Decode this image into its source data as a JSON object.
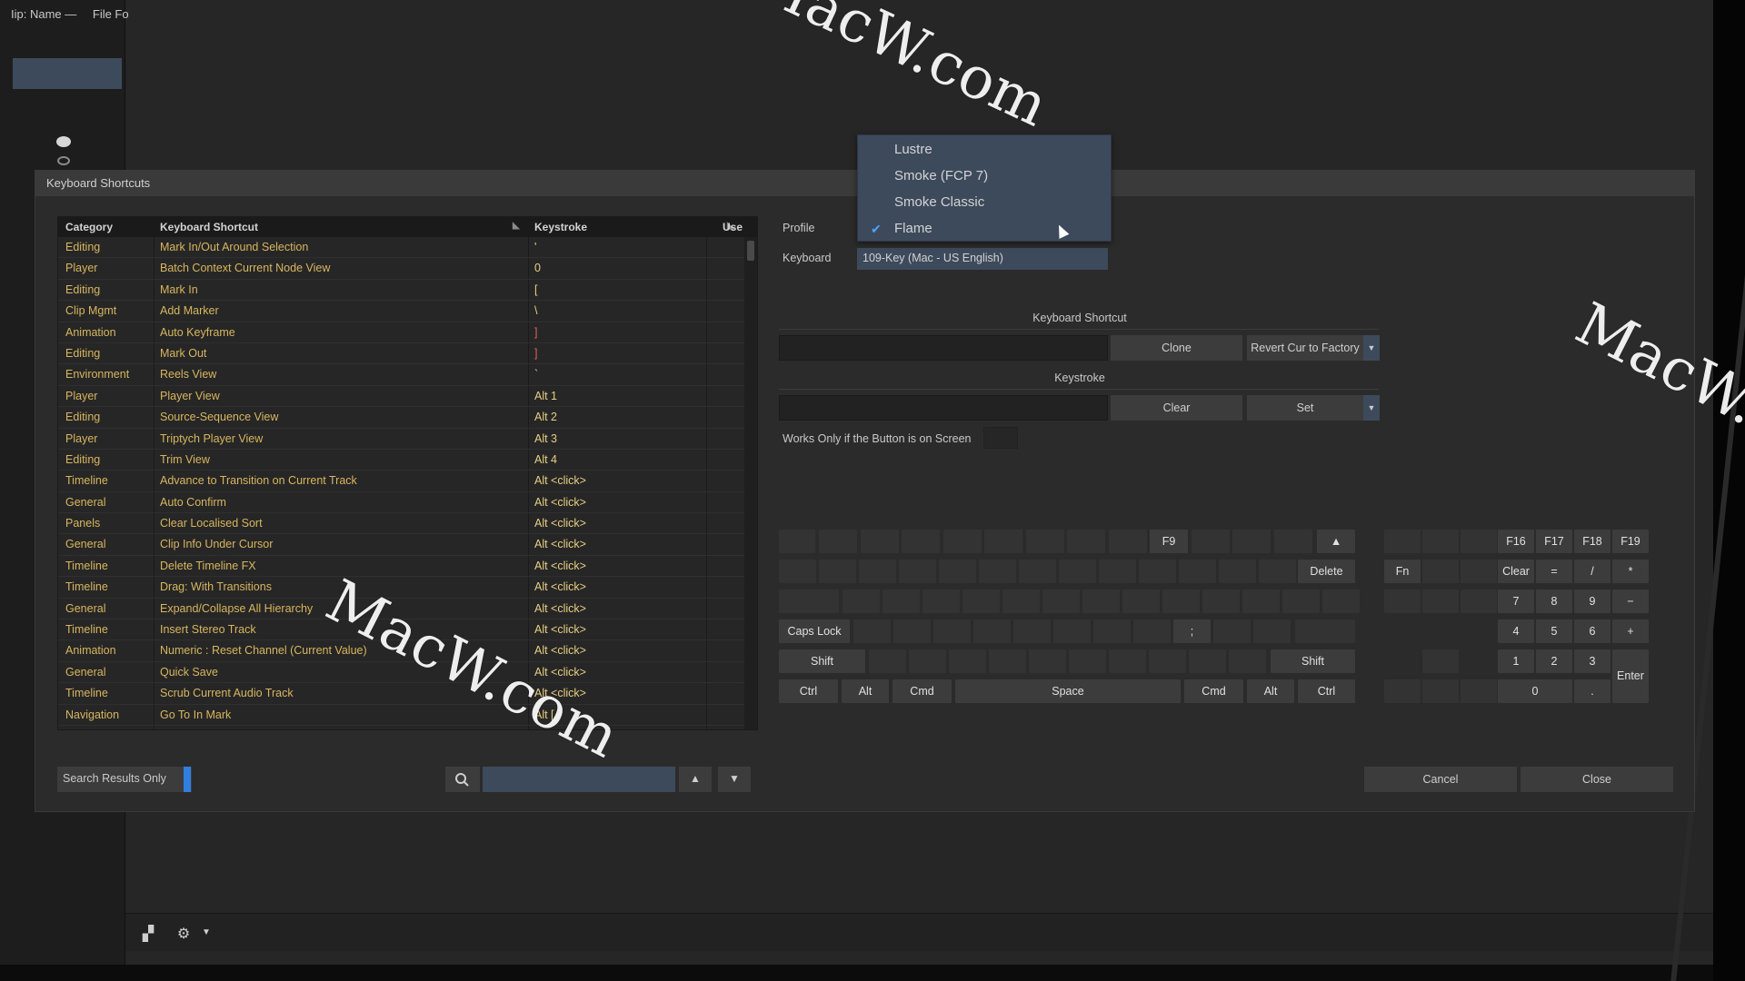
{
  "left_panel": {
    "header": [
      "Iip: Name —",
      "File Fo"
    ]
  },
  "dialog": {
    "title": "Keyboard Shortcuts",
    "columns": {
      "category": "Category",
      "shortcut": "Keyboard Shortcut",
      "keystroke": "Keystroke",
      "use": "Use"
    },
    "rows": [
      {
        "category": "Editing",
        "shortcut": "Mark In/Out Around Selection",
        "keystroke": "'"
      },
      {
        "category": "Player",
        "shortcut": "Batch Context Current Node View",
        "keystroke": "0"
      },
      {
        "category": "Editing",
        "shortcut": "Mark In",
        "keystroke": "["
      },
      {
        "category": "Clip Mgmt",
        "shortcut": "Add Marker",
        "keystroke": "\\"
      },
      {
        "category": "Animation",
        "shortcut": "Auto Keyframe",
        "keystroke": "]"
      },
      {
        "category": "Editing",
        "shortcut": "Mark Out",
        "keystroke": "]"
      },
      {
        "category": "Environment",
        "shortcut": "Reels View",
        "keystroke": "`"
      },
      {
        "category": "Player",
        "shortcut": "Player View",
        "keystroke": "Alt 1"
      },
      {
        "category": "Editing",
        "shortcut": "Source-Sequence View",
        "keystroke": "Alt 2"
      },
      {
        "category": "Player",
        "shortcut": "Triptych Player View",
        "keystroke": "Alt 3"
      },
      {
        "category": "Editing",
        "shortcut": "Trim View",
        "keystroke": "Alt 4"
      },
      {
        "category": "Timeline",
        "shortcut": "Advance to Transition on Current Track",
        "keystroke": "Alt <click>"
      },
      {
        "category": "General",
        "shortcut": "Auto Confirm",
        "keystroke": "Alt <click>"
      },
      {
        "category": "Panels",
        "shortcut": "Clear Localised Sort",
        "keystroke": "Alt <click>"
      },
      {
        "category": "General",
        "shortcut": "Clip Info Under Cursor",
        "keystroke": "Alt <click>"
      },
      {
        "category": "Timeline",
        "shortcut": "Delete Timeline FX",
        "keystroke": "Alt <click>"
      },
      {
        "category": "Timeline",
        "shortcut": "Drag: With Transitions",
        "keystroke": "Alt <click>"
      },
      {
        "category": "General",
        "shortcut": "Expand/Collapse All Hierarchy",
        "keystroke": "Alt <click>"
      },
      {
        "category": "Timeline",
        "shortcut": "Insert Stereo Track",
        "keystroke": "Alt <click>"
      },
      {
        "category": "Animation",
        "shortcut": "Numeric : Reset Channel (Current Value)",
        "keystroke": "Alt <click>"
      },
      {
        "category": "General",
        "shortcut": "Quick Save",
        "keystroke": "Alt <click>"
      },
      {
        "category": "Timeline",
        "shortcut": "Scrub Current Audio Track",
        "keystroke": "Alt <click>"
      },
      {
        "category": "Navigation",
        "shortcut": "Go To In Mark",
        "keystroke": "Alt ["
      }
    ],
    "search_only_label": "Search Results Only",
    "search_value": "",
    "profile_label": "Profile",
    "keyboard_label": "Keyboard",
    "keyboard_value": "109-Key (Mac - US English)",
    "profile_options": [
      "Lustre",
      "Smoke (FCP 7)",
      "Smoke Classic",
      "Flame"
    ],
    "profile_selected": "Flame",
    "shortcut_section": "Keyboard Shortcut",
    "clone_label": "Clone",
    "revert_label": "Revert Cur to Factory",
    "keystroke_section": "Keystroke",
    "clear_label": "Clear",
    "set_label": "Set",
    "works_only_label": "Works Only if the Button is on Screen",
    "cancel_label": "Cancel",
    "close_label": "Close"
  },
  "keyboard": {
    "f9": "F9",
    "delete": "Delete",
    "caps_lock": "Caps Lock",
    "shift": "Shift",
    "ctrl": "Ctrl",
    "alt": "Alt",
    "cmd": "Cmd",
    "space": "Space",
    "fn": "Fn",
    "enter": "Enter",
    "f16": "F16",
    "f17": "F17",
    "f18": "F18",
    "f19": "F19",
    "numpad_clear": "Clear",
    "numpad": [
      "=",
      "/",
      "*",
      "7",
      "8",
      "9",
      "−",
      "4",
      "5",
      "6",
      "+",
      "1",
      "2",
      "3",
      "0",
      "."
    ]
  },
  "watermark_text": "MacW.com"
}
